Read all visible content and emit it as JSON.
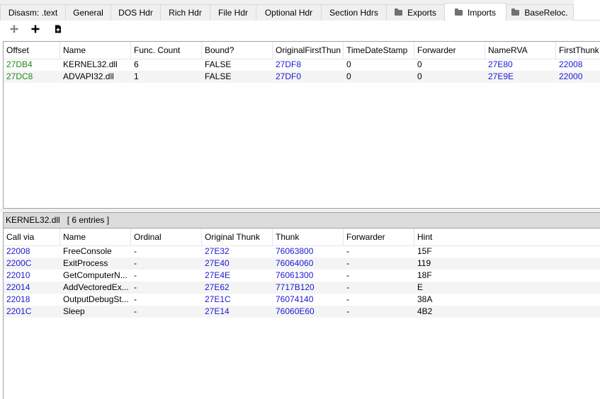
{
  "tabs": [
    {
      "label": "Disasm: .text",
      "icon": ""
    },
    {
      "label": "General",
      "icon": ""
    },
    {
      "label": "DOS Hdr",
      "icon": ""
    },
    {
      "label": "Rich Hdr",
      "icon": ""
    },
    {
      "label": "File Hdr",
      "icon": ""
    },
    {
      "label": "Optional Hdr",
      "icon": ""
    },
    {
      "label": "Section Hdrs",
      "icon": ""
    },
    {
      "label": "Exports",
      "icon": "folder-icon"
    },
    {
      "label": "Imports",
      "icon": "folder-icon"
    },
    {
      "label": "BaseReloc.",
      "icon": "folder-icon"
    }
  ],
  "active_tab": "Imports",
  "toolbar": {
    "icons": [
      "move-icon",
      "add-icon",
      "add-document-icon"
    ]
  },
  "imports_table": {
    "columns": [
      "Offset",
      "Name",
      "Func. Count",
      "Bound?",
      "OriginalFirstThun",
      "TimeDateStamp",
      "Forwarder",
      "NameRVA",
      "FirstThunk"
    ],
    "rows": [
      [
        "27DB4",
        "KERNEL32.dll",
        "6",
        "FALSE",
        "27DF8",
        "0",
        "0",
        "27E80",
        "22008"
      ],
      [
        "27DC8",
        "ADVAPI32.dll",
        "1",
        "FALSE",
        "27DF0",
        "0",
        "0",
        "27E9E",
        "22000"
      ]
    ]
  },
  "lower_pane": {
    "label": "KERNEL32.dll   [ 6 entries ]"
  },
  "functions_table": {
    "columns": [
      "Call via",
      "Name",
      "Ordinal",
      "Original Thunk",
      "Thunk",
      "Forwarder",
      "Hint"
    ],
    "rows": [
      [
        "22008",
        "FreeConsole",
        "-",
        "27E32",
        "76063800",
        "-",
        "15F"
      ],
      [
        "2200C",
        "ExitProcess",
        "-",
        "27E40",
        "76064060",
        "-",
        "119"
      ],
      [
        "22010",
        "GetComputerN...",
        "-",
        "27E4E",
        "76061300",
        "-",
        "18F"
      ],
      [
        "22014",
        "AddVectoredEx...",
        "-",
        "27E62",
        "7717B120",
        "-",
        "E"
      ],
      [
        "22018",
        "OutputDebugSt...",
        "-",
        "27E1C",
        "76074140",
        "-",
        "38A"
      ],
      [
        "2201C",
        "Sleep",
        "-",
        "27E14",
        "76060E60",
        "-",
        "4B2"
      ]
    ]
  },
  "colors": {
    "offset_green": "#1d8a1d",
    "rva_blue": "#1a1ad6"
  }
}
